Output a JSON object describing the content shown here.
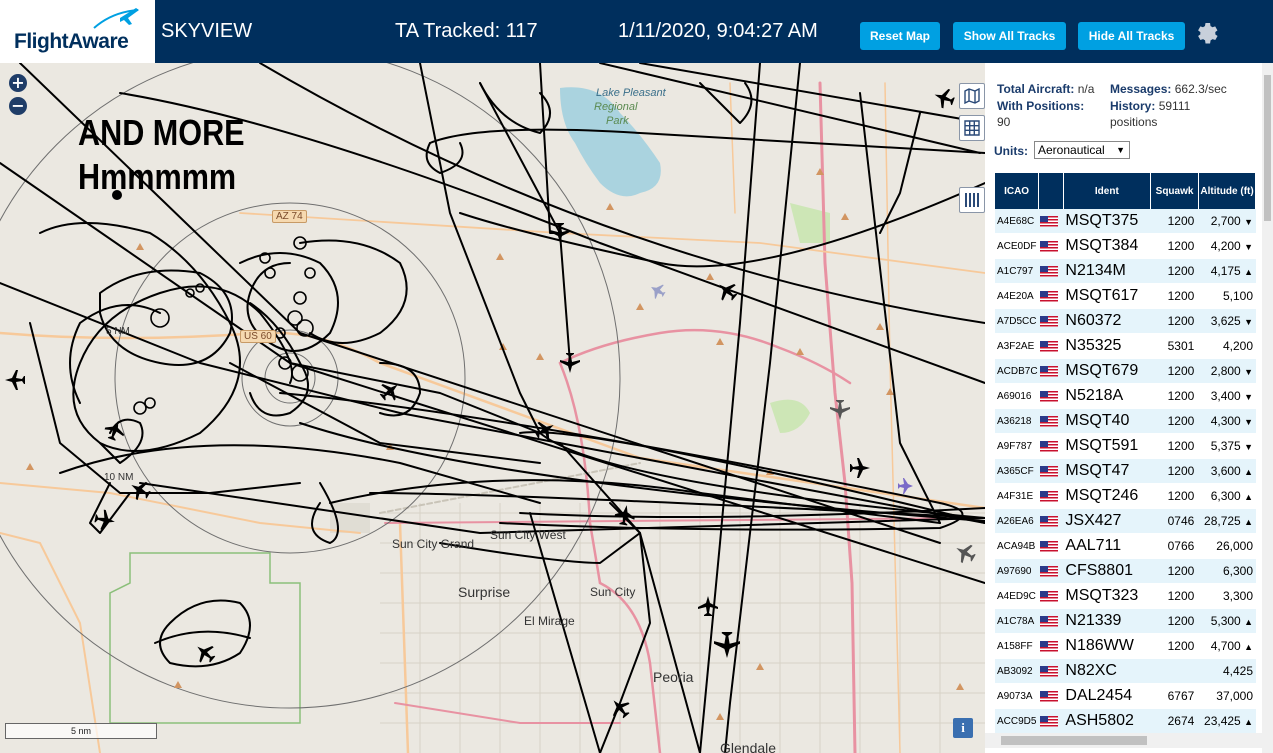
{
  "header": {
    "logo_text": "FlightAware",
    "app_name": "SKYVIEW",
    "tracked": "TA Tracked: 117",
    "datetime": "1/11/2020, 9:04:27 AM",
    "buttons": {
      "reset": "Reset Map",
      "show_all": "Show All Tracks",
      "hide_all": "Hide All Tracks"
    }
  },
  "map": {
    "annotation_line1": "AND MORE",
    "annotation_line2": "Hmmmmm",
    "labels": {
      "lake": "Lake Pleasant",
      "regional": "Regional",
      "park": "Park",
      "sun_city_grand": "Sun City Grand",
      "sun_city_west": "Sun City West",
      "surprise": "Surprise",
      "sun_city": "Sun City",
      "el_mirage": "El Mirage",
      "peoria": "Peoria",
      "glendale": "Glendale",
      "az74": "AZ 74",
      "us60": "US 60",
      "ring5": "5 NM",
      "ring10": "10 NM"
    },
    "scale_label": "5 nm"
  },
  "panel": {
    "total_aircraft_label": "Total Aircraft:",
    "total_aircraft_value": "n/a",
    "messages_label": "Messages:",
    "messages_value": "662.3/sec",
    "with_positions_label": "With Positions:",
    "with_positions_value": "90",
    "history_label": "History:",
    "history_value": "59111 positions",
    "units_label": "Units:",
    "units_value": "Aeronautical"
  },
  "table": {
    "headers": {
      "icao": "ICAO",
      "ident": "Ident",
      "squawk": "Squawk",
      "altitude": "Altitude (ft)"
    },
    "rows": [
      {
        "icao": "A4E68C",
        "ident": "MSQT375",
        "squawk": "1200",
        "alt": "2,700",
        "trend": "▼"
      },
      {
        "icao": "ACE0DF",
        "ident": "MSQT384",
        "squawk": "1200",
        "alt": "4,200",
        "trend": "▼"
      },
      {
        "icao": "A1C797",
        "ident": "N2134M",
        "squawk": "1200",
        "alt": "4,175",
        "trend": "▲"
      },
      {
        "icao": "A4E20A",
        "ident": "MSQT617",
        "squawk": "1200",
        "alt": "5,100",
        "trend": ""
      },
      {
        "icao": "A7D5CC",
        "ident": "N60372",
        "squawk": "1200",
        "alt": "3,625",
        "trend": "▼"
      },
      {
        "icao": "A3F2AE",
        "ident": "N35325",
        "squawk": "5301",
        "alt": "4,200",
        "trend": ""
      },
      {
        "icao": "ACDB7C",
        "ident": "MSQT679",
        "squawk": "1200",
        "alt": "2,800",
        "trend": "▼"
      },
      {
        "icao": "A69016",
        "ident": "N5218A",
        "squawk": "1200",
        "alt": "3,400",
        "trend": "▼"
      },
      {
        "icao": "A36218",
        "ident": "MSQT40",
        "squawk": "1200",
        "alt": "4,300",
        "trend": "▼"
      },
      {
        "icao": "A9F787",
        "ident": "MSQT591",
        "squawk": "1200",
        "alt": "5,375",
        "trend": "▼"
      },
      {
        "icao": "A365CF",
        "ident": "MSQT47",
        "squawk": "1200",
        "alt": "3,600",
        "trend": "▲"
      },
      {
        "icao": "A4F31E",
        "ident": "MSQT246",
        "squawk": "1200",
        "alt": "6,300",
        "trend": "▲"
      },
      {
        "icao": "A26EA6",
        "ident": "JSX427",
        "squawk": "0746",
        "alt": "28,725",
        "trend": "▲"
      },
      {
        "icao": "ACA94B",
        "ident": "AAL711",
        "squawk": "0766",
        "alt": "26,000",
        "trend": ""
      },
      {
        "icao": "A97690",
        "ident": "CFS8801",
        "squawk": "1200",
        "alt": "6,300",
        "trend": ""
      },
      {
        "icao": "A4ED9C",
        "ident": "MSQT323",
        "squawk": "1200",
        "alt": "3,300",
        "trend": ""
      },
      {
        "icao": "A1C78A",
        "ident": "N21339",
        "squawk": "1200",
        "alt": "5,300",
        "trend": "▲"
      },
      {
        "icao": "A158FF",
        "ident": "N186WW",
        "squawk": "1200",
        "alt": "4,700",
        "trend": "▲"
      },
      {
        "icao": "AB3092",
        "ident": "N82XC",
        "squawk": "",
        "alt": "4,425",
        "trend": ""
      },
      {
        "icao": "A9073A",
        "ident": "DAL2454",
        "squawk": "6767",
        "alt": "37,000",
        "trend": ""
      },
      {
        "icao": "ACC9D5",
        "ident": "ASH5802",
        "squawk": "2674",
        "alt": "23,425",
        "trend": "▲"
      }
    ]
  },
  "colors": {
    "header_bg": "#002f5d",
    "button_bg": "#00a0e2",
    "row_alt": "#e5f4fb",
    "track": "#000000"
  }
}
